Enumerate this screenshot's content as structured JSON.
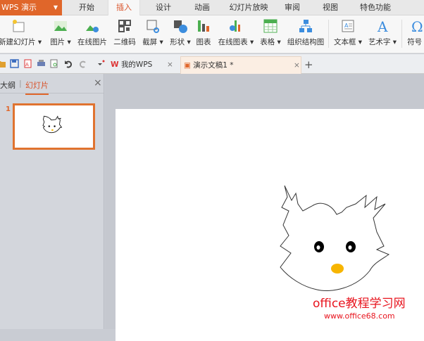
{
  "app": {
    "name": "WPS 演示"
  },
  "menu_tabs": [
    "开始",
    "插入",
    "设计",
    "动画",
    "幻灯片放映",
    "审阅",
    "视图",
    "特色功能"
  ],
  "active_tab": "插入",
  "ribbon": [
    {
      "label": "新建幻灯片",
      "dropdown": true
    },
    {
      "label": "图片",
      "dropdown": true
    },
    {
      "label": "在线图片",
      "dropdown": false
    },
    {
      "label": "二维码",
      "dropdown": false
    },
    {
      "label": "截屏",
      "dropdown": true
    },
    {
      "label": "形状",
      "dropdown": true
    },
    {
      "label": "图表",
      "dropdown": false
    },
    {
      "label": "在线图表",
      "dropdown": true
    },
    {
      "label": "表格",
      "dropdown": true
    },
    {
      "label": "组织结构图",
      "dropdown": false
    },
    {
      "label": "文本框",
      "dropdown": true
    },
    {
      "label": "艺术字",
      "dropdown": true
    },
    {
      "label": "符号",
      "dropdown": true
    }
  ],
  "doc_tabs": [
    {
      "label": "我的WPS",
      "close": "×"
    },
    {
      "label": "演示文稿1 *",
      "close": "×"
    }
  ],
  "new_tab": "+",
  "left_panel": {
    "tabs": [
      "大纲",
      "幻灯片"
    ],
    "separator": "|",
    "active": "幻灯片",
    "close": "×",
    "slides": [
      {
        "number": "1"
      }
    ]
  },
  "watermark": {
    "line1": "office教程学习网",
    "line2": "www.office68.com"
  },
  "colors": {
    "accent": "#e0662a",
    "active_tab_text": "#d9532a",
    "nose": "#f7b500"
  }
}
